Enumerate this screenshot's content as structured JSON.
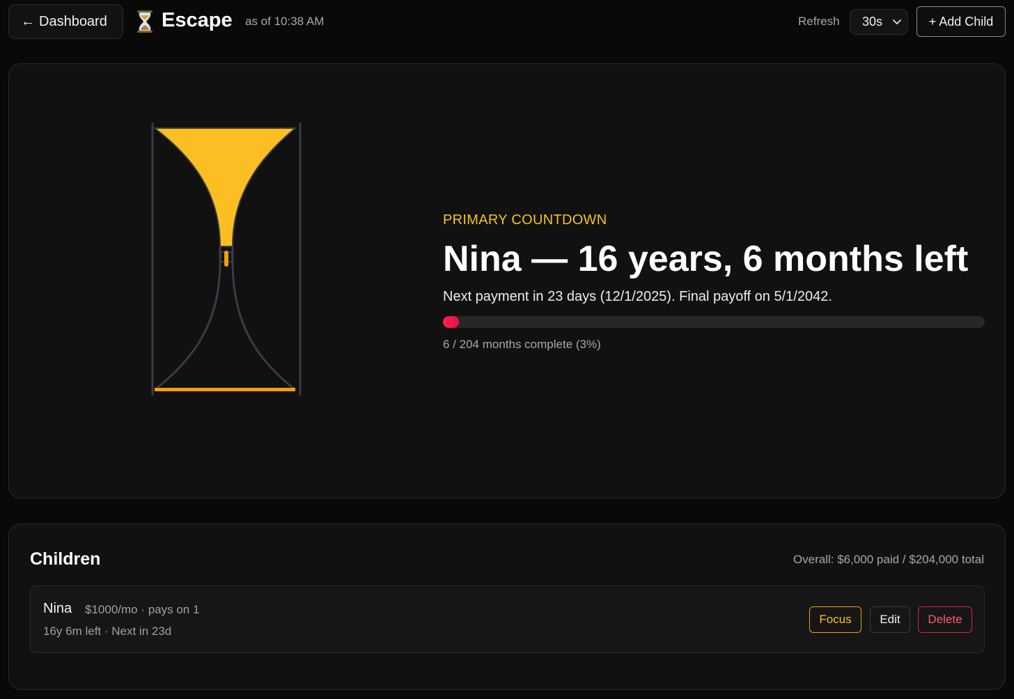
{
  "header": {
    "back_label": "Dashboard",
    "back_arrow": "←",
    "app_icon": "hourglass-icon",
    "title": "Escape",
    "as_of": "as of 10:38 AM",
    "refresh_label": "Refresh",
    "refresh_value": "30s",
    "add_child_label": "+ Add Child"
  },
  "primary": {
    "eyebrow": "PRIMARY COUNTDOWN",
    "title": "Nina — 16 years, 6 months left",
    "subtitle": "Next payment in 23 days (12/1/2025). Final payoff on 5/1/2042.",
    "progress_fraction": 0.03,
    "progress_text": "6 / 204 months complete (3%)"
  },
  "children": {
    "title": "Children",
    "overall": "Overall: $6,000 paid / $204,000 total",
    "items": [
      {
        "name": "Nina",
        "meta": "$1000/mo · pays on 1",
        "status": "16y 6m left · Next in 23d",
        "focus_label": "Focus",
        "edit_label": "Edit",
        "delete_label": "Delete"
      }
    ]
  },
  "colors": {
    "background": "#090909",
    "panel": "#111111",
    "sand": "#fbbf24",
    "accent_yellow": "#f4c41a",
    "progress": "#ff1f4f",
    "delete": "#e11d48"
  }
}
